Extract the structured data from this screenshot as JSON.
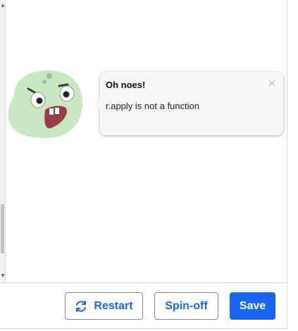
{
  "error_bubble": {
    "title": "Oh noes!",
    "close_symbol": "×",
    "message": "r.apply is not a function"
  },
  "buddy": {
    "icon": "error-buddy-icon",
    "skin_color": "#c8e6c0"
  },
  "toolbar": {
    "restart_label": "Restart",
    "restart_icon": "restart-icon",
    "spinoff_label": "Spin-off",
    "save_label": "Save"
  },
  "colors": {
    "primary": "#1865f2",
    "outline_border": "#878a8d",
    "bubble_bg": "#f8f8f8"
  }
}
